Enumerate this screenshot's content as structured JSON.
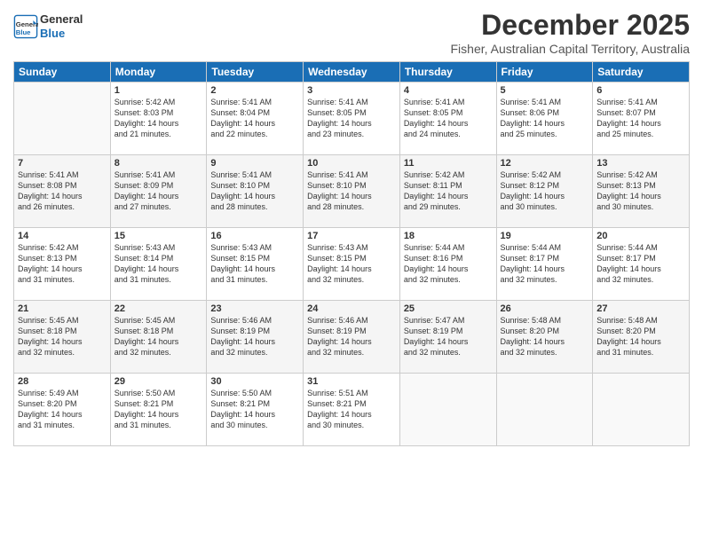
{
  "header": {
    "logo_line1": "General",
    "logo_line2": "Blue",
    "title": "December 2025",
    "subtitle": "Fisher, Australian Capital Territory, Australia"
  },
  "days_of_week": [
    "Sunday",
    "Monday",
    "Tuesday",
    "Wednesday",
    "Thursday",
    "Friday",
    "Saturday"
  ],
  "weeks": [
    [
      {
        "num": "",
        "detail": ""
      },
      {
        "num": "1",
        "detail": "Sunrise: 5:42 AM\nSunset: 8:03 PM\nDaylight: 14 hours\nand 21 minutes."
      },
      {
        "num": "2",
        "detail": "Sunrise: 5:41 AM\nSunset: 8:04 PM\nDaylight: 14 hours\nand 22 minutes."
      },
      {
        "num": "3",
        "detail": "Sunrise: 5:41 AM\nSunset: 8:05 PM\nDaylight: 14 hours\nand 23 minutes."
      },
      {
        "num": "4",
        "detail": "Sunrise: 5:41 AM\nSunset: 8:05 PM\nDaylight: 14 hours\nand 24 minutes."
      },
      {
        "num": "5",
        "detail": "Sunrise: 5:41 AM\nSunset: 8:06 PM\nDaylight: 14 hours\nand 25 minutes."
      },
      {
        "num": "6",
        "detail": "Sunrise: 5:41 AM\nSunset: 8:07 PM\nDaylight: 14 hours\nand 25 minutes."
      }
    ],
    [
      {
        "num": "7",
        "detail": "Sunrise: 5:41 AM\nSunset: 8:08 PM\nDaylight: 14 hours\nand 26 minutes."
      },
      {
        "num": "8",
        "detail": "Sunrise: 5:41 AM\nSunset: 8:09 PM\nDaylight: 14 hours\nand 27 minutes."
      },
      {
        "num": "9",
        "detail": "Sunrise: 5:41 AM\nSunset: 8:10 PM\nDaylight: 14 hours\nand 28 minutes."
      },
      {
        "num": "10",
        "detail": "Sunrise: 5:41 AM\nSunset: 8:10 PM\nDaylight: 14 hours\nand 28 minutes."
      },
      {
        "num": "11",
        "detail": "Sunrise: 5:42 AM\nSunset: 8:11 PM\nDaylight: 14 hours\nand 29 minutes."
      },
      {
        "num": "12",
        "detail": "Sunrise: 5:42 AM\nSunset: 8:12 PM\nDaylight: 14 hours\nand 30 minutes."
      },
      {
        "num": "13",
        "detail": "Sunrise: 5:42 AM\nSunset: 8:13 PM\nDaylight: 14 hours\nand 30 minutes."
      }
    ],
    [
      {
        "num": "14",
        "detail": "Sunrise: 5:42 AM\nSunset: 8:13 PM\nDaylight: 14 hours\nand 31 minutes."
      },
      {
        "num": "15",
        "detail": "Sunrise: 5:43 AM\nSunset: 8:14 PM\nDaylight: 14 hours\nand 31 minutes."
      },
      {
        "num": "16",
        "detail": "Sunrise: 5:43 AM\nSunset: 8:15 PM\nDaylight: 14 hours\nand 31 minutes."
      },
      {
        "num": "17",
        "detail": "Sunrise: 5:43 AM\nSunset: 8:15 PM\nDaylight: 14 hours\nand 32 minutes."
      },
      {
        "num": "18",
        "detail": "Sunrise: 5:44 AM\nSunset: 8:16 PM\nDaylight: 14 hours\nand 32 minutes."
      },
      {
        "num": "19",
        "detail": "Sunrise: 5:44 AM\nSunset: 8:17 PM\nDaylight: 14 hours\nand 32 minutes."
      },
      {
        "num": "20",
        "detail": "Sunrise: 5:44 AM\nSunset: 8:17 PM\nDaylight: 14 hours\nand 32 minutes."
      }
    ],
    [
      {
        "num": "21",
        "detail": "Sunrise: 5:45 AM\nSunset: 8:18 PM\nDaylight: 14 hours\nand 32 minutes."
      },
      {
        "num": "22",
        "detail": "Sunrise: 5:45 AM\nSunset: 8:18 PM\nDaylight: 14 hours\nand 32 minutes."
      },
      {
        "num": "23",
        "detail": "Sunrise: 5:46 AM\nSunset: 8:19 PM\nDaylight: 14 hours\nand 32 minutes."
      },
      {
        "num": "24",
        "detail": "Sunrise: 5:46 AM\nSunset: 8:19 PM\nDaylight: 14 hours\nand 32 minutes."
      },
      {
        "num": "25",
        "detail": "Sunrise: 5:47 AM\nSunset: 8:19 PM\nDaylight: 14 hours\nand 32 minutes."
      },
      {
        "num": "26",
        "detail": "Sunrise: 5:48 AM\nSunset: 8:20 PM\nDaylight: 14 hours\nand 32 minutes."
      },
      {
        "num": "27",
        "detail": "Sunrise: 5:48 AM\nSunset: 8:20 PM\nDaylight: 14 hours\nand 31 minutes."
      }
    ],
    [
      {
        "num": "28",
        "detail": "Sunrise: 5:49 AM\nSunset: 8:20 PM\nDaylight: 14 hours\nand 31 minutes."
      },
      {
        "num": "29",
        "detail": "Sunrise: 5:50 AM\nSunset: 8:21 PM\nDaylight: 14 hours\nand 31 minutes."
      },
      {
        "num": "30",
        "detail": "Sunrise: 5:50 AM\nSunset: 8:21 PM\nDaylight: 14 hours\nand 30 minutes."
      },
      {
        "num": "31",
        "detail": "Sunrise: 5:51 AM\nSunset: 8:21 PM\nDaylight: 14 hours\nand 30 minutes."
      },
      {
        "num": "",
        "detail": ""
      },
      {
        "num": "",
        "detail": ""
      },
      {
        "num": "",
        "detail": ""
      }
    ]
  ]
}
